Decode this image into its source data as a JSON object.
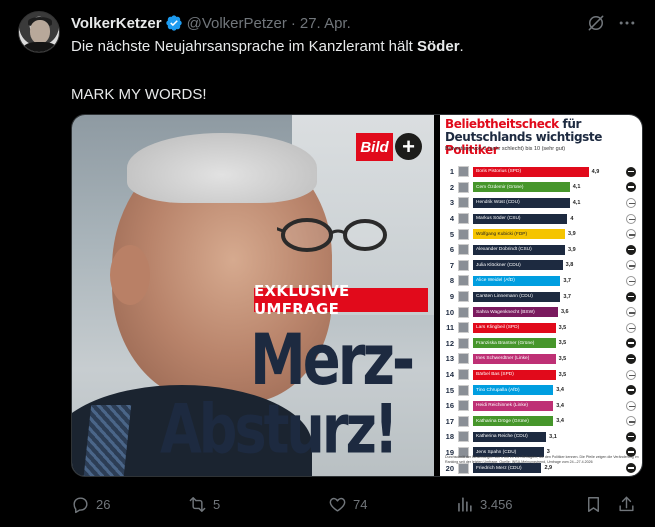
{
  "author": {
    "display_name": "VolkerKetzer",
    "handle": "@VolkerPetzer",
    "separator": "·",
    "date": "27. Apr."
  },
  "tweet": {
    "text_before": "Die nächste Neujahrsansprache im Kanzleramt hält ",
    "text_bold": "Söder",
    "text_after": ".",
    "line2": "MARK MY WORDS!"
  },
  "media": {
    "bild_logo": "Bild",
    "plus": "+",
    "label": "EXKLUSIVE UMFRAGE",
    "headline_line1": "Merz-",
    "headline_line2": "Absturz!",
    "chart": {
      "title_red1": "Beliebtheitscheck",
      "title_dark1": " für",
      "title_dark2": "Deutschlands wichtigste ",
      "title_red2": "Politiker",
      "subtitle": "Bewertung von 0 (sehr schlecht) bis 10 (sehr gut)",
      "footnote": "Durchschnitt der Bewertungen von 0 bis 10 von Befragten, die den Politiker kennen. Die Pfeile zeigen die Veränderung im Ranking seit der letzten Umfrage. Quelle: INSA-Meinungstrend, Umfrage vom 24.–27.4.2026"
    }
  },
  "chart_data": {
    "type": "bar",
    "title": "Beliebtheitscheck für Deutschlands wichtigste Politiker",
    "subtitle": "Bewertung von 0 (sehr schlecht) bis 10 (sehr gut)",
    "xlim": [
      0,
      5
    ],
    "categories": [
      "Boris Pistorius (SPD)",
      "Cem Özdemir (Grüne)",
      "Hendrik Wüst (CDU)",
      "Markus Söder (CSU)",
      "Wolfgang Kubicki (FDP)",
      "Alexander Dobrindt (CSU)",
      "Julia Klöckner (CDU)",
      "Alice Weidel (AfD)",
      "Carsten Linnemann (CDU)",
      "Sahra Wagenknecht (BSW)",
      "Lars Klingbeil (SPD)",
      "Franziska Brantner (Grüne)",
      "Ines Schwerdtner (Linke)",
      "Bärbel Bas (SPD)",
      "Tino Chrupalla (AfD)",
      "Heidi Reichinnek (Linke)",
      "Katharina Dröge (Grüne)",
      "Katherina Reiche (CDU)",
      "Jens Spahn (CDU)",
      "Friedrich Merz (CDU)"
    ],
    "values": [
      4.9,
      4.1,
      4.1,
      4.0,
      3.9,
      3.9,
      3.8,
      3.7,
      3.7,
      3.6,
      3.5,
      3.5,
      3.5,
      3.5,
      3.4,
      3.4,
      3.4,
      3.1,
      3.0,
      2.9
    ],
    "party_colors": [
      "#e10a1b",
      "#46962b",
      "#1d2a40",
      "#1d2a40",
      "#f5c400",
      "#1d2a40",
      "#1d2a40",
      "#009ee0",
      "#1d2a40",
      "#7a1a5e",
      "#e10a1b",
      "#46962b",
      "#be3075",
      "#e10a1b",
      "#009ee0",
      "#be3075",
      "#46962b",
      "#1d2a40",
      "#1d2a40",
      "#1d2a40"
    ],
    "arrow_dark": [
      true,
      true,
      false,
      false,
      false,
      true,
      false,
      false,
      true,
      false,
      false,
      true,
      true,
      false,
      true,
      false,
      false,
      true,
      true,
      true
    ]
  },
  "actions": {
    "replies": "26",
    "retweets": "5",
    "likes": "74",
    "views": "3.456"
  }
}
